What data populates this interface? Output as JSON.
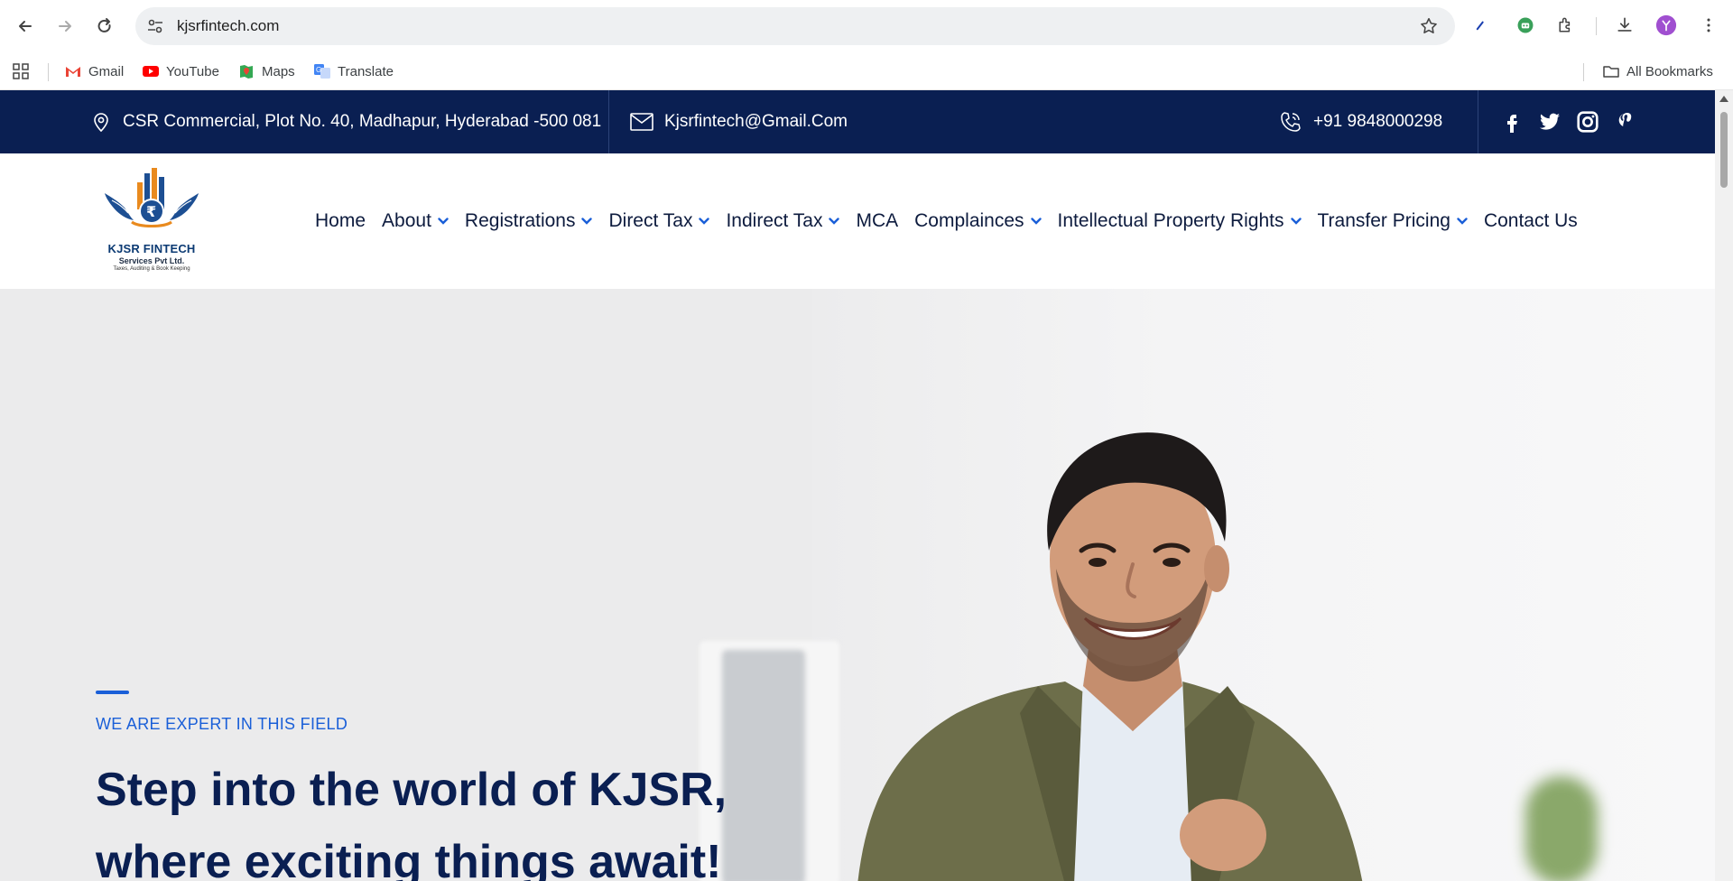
{
  "browser": {
    "url": "kjsrfintech.com",
    "bookmarks": [
      {
        "label": "Gmail",
        "icon": "gmail-icon"
      },
      {
        "label": "YouTube",
        "icon": "youtube-icon"
      },
      {
        "label": "Maps",
        "icon": "maps-icon"
      },
      {
        "label": "Translate",
        "icon": "translate-icon"
      }
    ],
    "all_bookmarks_label": "All Bookmarks"
  },
  "topbar": {
    "address": "CSR Commercial, Plot No. 40, Madhapur, Hyderabad -500 081",
    "email": "Kjsrfintech@Gmail.Com",
    "phone": "+91 9848000298",
    "social": [
      "facebook-icon",
      "twitter-icon",
      "instagram-icon",
      "pinterest-icon"
    ],
    "bg_color": "#0a1f52"
  },
  "logo": {
    "name": "KJSR FINTECH",
    "subtitle": "Services Pvt Ltd.",
    "tagline": "Taxes, Auditing & Book Keeping"
  },
  "menu": [
    {
      "label": "Home",
      "dropdown": false
    },
    {
      "label": "About",
      "dropdown": true
    },
    {
      "label": "Registrations",
      "dropdown": true
    },
    {
      "label": "Direct Tax",
      "dropdown": true
    },
    {
      "label": "Indirect Tax",
      "dropdown": true
    },
    {
      "label": "MCA",
      "dropdown": false
    },
    {
      "label": "Complainces",
      "dropdown": true
    },
    {
      "label": "Intellectual Property Rights",
      "dropdown": true
    },
    {
      "label": "Transfer Pricing",
      "dropdown": true
    },
    {
      "label": "Contact Us",
      "dropdown": false
    }
  ],
  "hero": {
    "kicker": "WE ARE EXPERT IN THIS FIELD",
    "title": "Step into the world of KJSR, where exciting things await!",
    "accent_color": "#1a5fd8"
  }
}
